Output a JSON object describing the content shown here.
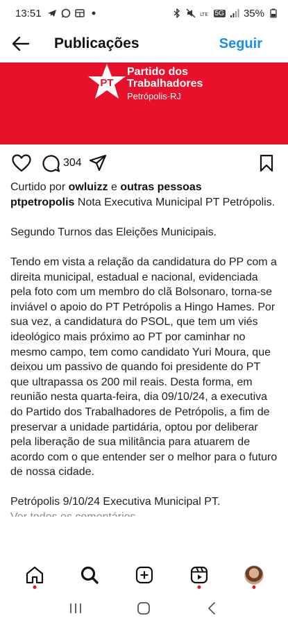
{
  "status_bar": {
    "time": "13:51",
    "battery": "35%",
    "network": "5G"
  },
  "header": {
    "title": "Publicações",
    "follow_label": "Seguir"
  },
  "post_image": {
    "logo_text": "PT",
    "party_line1": "Partido dos",
    "party_line2": "Trabalhadores",
    "party_city": "Petrópolis-RJ",
    "background_color": "#e8102a"
  },
  "actions": {
    "comment_count": "304"
  },
  "caption": {
    "liked_prefix": "Curtido por",
    "liked_user": "owluizz",
    "liked_connector": "e",
    "liked_others": "outras pessoas",
    "author": "ptpetropolis",
    "title_text": "Nota Executiva Municipal PT Petrópolis.",
    "paragraph1": "Segundo Turnos das Eleições Municipais.",
    "paragraph2": "Tendo em vista a relação da candidatura do PP com a direita municipal, estadual e nacional, evidenciada pela foto com um membro do clã Bolsonaro, torna-se inviável o apoio do PT Petrópolis a Hingo Hames. Por sua vez, a candidatura do PSOL, que tem um viés ideológico mais próximo ao PT por caminhar no mesmo campo, tem como candidato Yuri Moura, que deixou um passivo de quando foi presidente do PT que ultrapassa os 200 mil reais. Desta forma, em reunião nesta quarta-feira, dia 09/10/24, a executiva do Partido dos Trabalhadores de Petrópolis, a fim de preservar a unidade partidária, optou por deliberar pela liberação de sua militância para atuarem de acordo com o que entender ser o melhor para o futuro de nossa cidade.",
    "paragraph3": "Petrópolis 9/10/24 Executiva Municipal PT.",
    "view_comments": "Ver todos os comentários"
  },
  "bottom_nav": {
    "items": [
      "home-icon",
      "search-icon",
      "create-icon",
      "reels-icon",
      "profile-avatar"
    ]
  }
}
